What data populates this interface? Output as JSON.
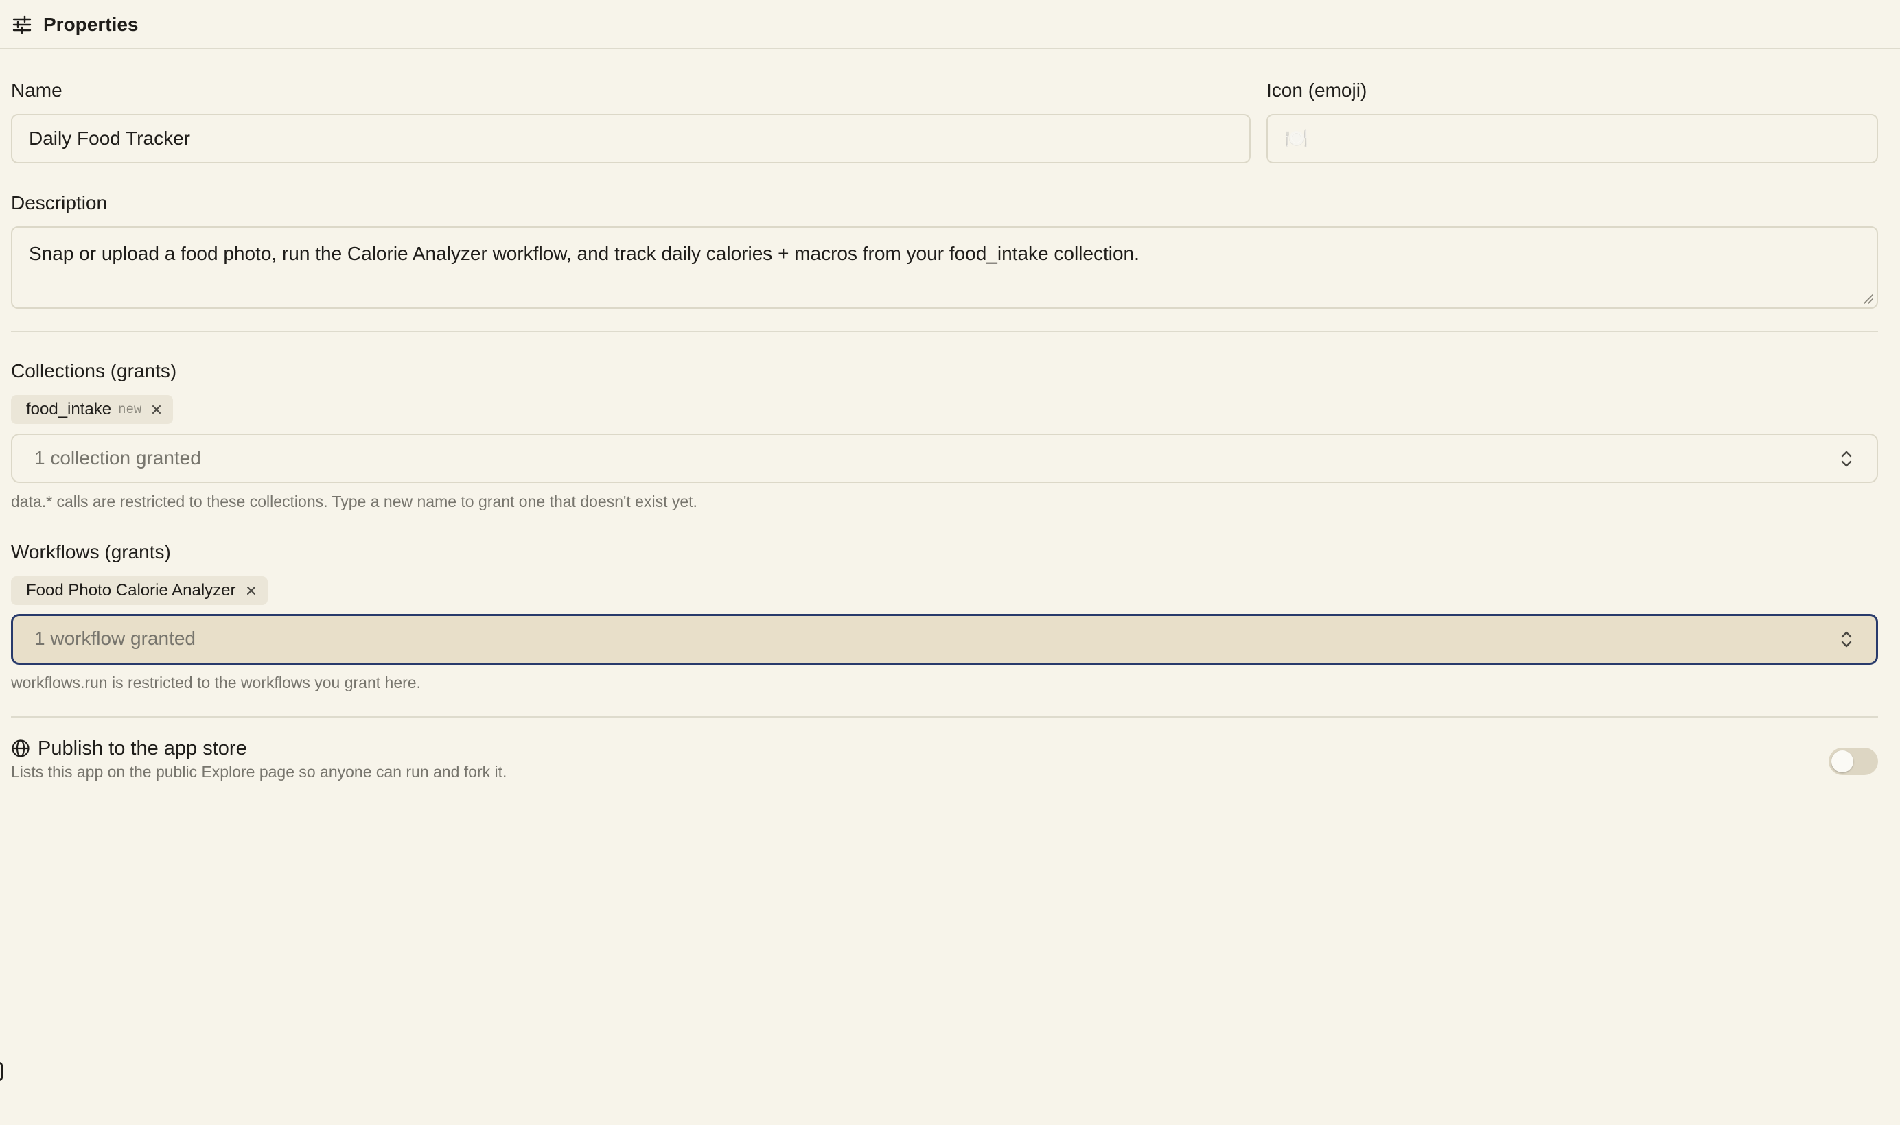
{
  "header": {
    "title": "Properties",
    "icon": "sliders-icon"
  },
  "name": {
    "label": "Name",
    "value": "Daily Food Tracker"
  },
  "icon_field": {
    "label": "Icon (emoji)",
    "value": "🍽️"
  },
  "description": {
    "label": "Description",
    "value": "Snap or upload a food photo, run the Calorie Analyzer workflow, and track daily calories + macros from your food_intake collection."
  },
  "collections": {
    "label": "Collections (grants)",
    "chips": [
      {
        "label": "food_intake",
        "tag": "new"
      }
    ],
    "select_value": "1 collection granted",
    "hint": "data.* calls are restricted to these collections. Type a new name to grant one that doesn't exist yet."
  },
  "workflows": {
    "label": "Workflows (grants)",
    "chips": [
      {
        "label": "Food Photo Calorie Analyzer"
      }
    ],
    "select_value": "1 workflow granted",
    "hint": "workflows.run is restricted to the workflows you grant here."
  },
  "publish": {
    "title": "Publish to the app store",
    "description": "Lists this app on the public Explore page so anyone can run and fork it.",
    "enabled": false
  },
  "colors": {
    "background": "#f7f4ea",
    "focus_border": "#283a6b",
    "focused_fill": "#e8dfc9",
    "chip_bg": "#ebe6d8"
  }
}
